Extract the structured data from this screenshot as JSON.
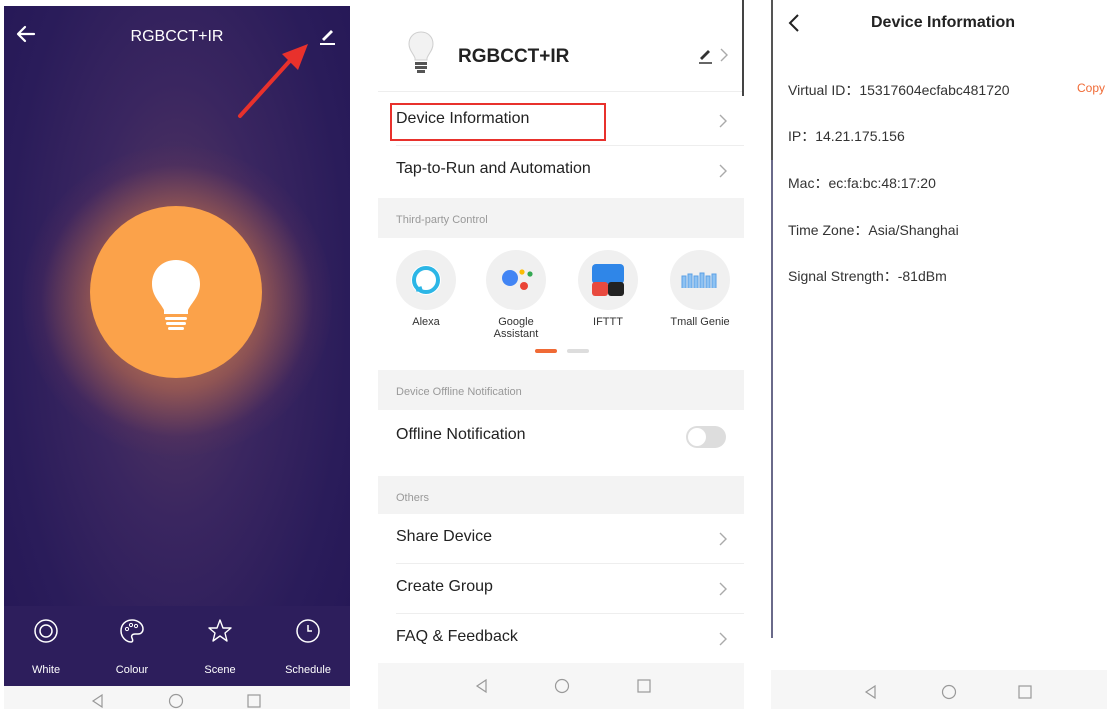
{
  "panel1": {
    "title": "RGBCCT+IR",
    "icons": {
      "back": "arrow-left-icon",
      "edit": "pencil-icon",
      "bulb": "lightbulb-icon"
    },
    "bottom_nav": [
      {
        "label": "White",
        "icon": "ring-icon"
      },
      {
        "label": "Colour",
        "icon": "palette-icon"
      },
      {
        "label": "Scene",
        "icon": "star-icon"
      },
      {
        "label": "Schedule",
        "icon": "clock-icon"
      }
    ],
    "colors": {
      "bulb": "#fba24a",
      "background": "#2a1c5a",
      "annotation_arrow": "#e8312c"
    }
  },
  "panel2": {
    "device_name": "RGBCCT+IR",
    "rows": {
      "device_information": "Device Information",
      "tap_to_run": "Tap-to-Run and Automation",
      "offline_notification": "Offline Notification",
      "share_device": "Share Device",
      "create_group": "Create Group",
      "faq": "FAQ & Feedback"
    },
    "sections": {
      "third_party": "Third-party Control",
      "offline": "Device Offline Notification",
      "others": "Others"
    },
    "third_party_items": [
      {
        "label": "Alexa",
        "icon": "alexa-icon"
      },
      {
        "label": "Google\nAssistant",
        "icon": "google-assistant-icon"
      },
      {
        "label": "IFTTT",
        "icon": "ifttt-icon"
      },
      {
        "label": "Tmall Genie",
        "icon": "tmall-genie-icon"
      }
    ],
    "offline_toggle_on": false,
    "colors": {
      "highlight_box": "#e8312c",
      "page_indicator_active": "#f06a35"
    }
  },
  "panel3": {
    "title": "Device Information",
    "copy_label": "Copy",
    "info": {
      "virtual_id": "Virtual ID：15317604ecfabc481720",
      "ip": "IP：14.21.175.156",
      "mac": "Mac：ec:fa:bc:48:17:20",
      "time_zone": "Time Zone：Asia/Shanghai",
      "signal": "Signal Strength：-81dBm"
    },
    "colors": {
      "copy": "#f06a35"
    }
  },
  "system_nav": {
    "icons": [
      "back-triangle-icon",
      "home-circle-icon",
      "recents-square-icon"
    ]
  }
}
